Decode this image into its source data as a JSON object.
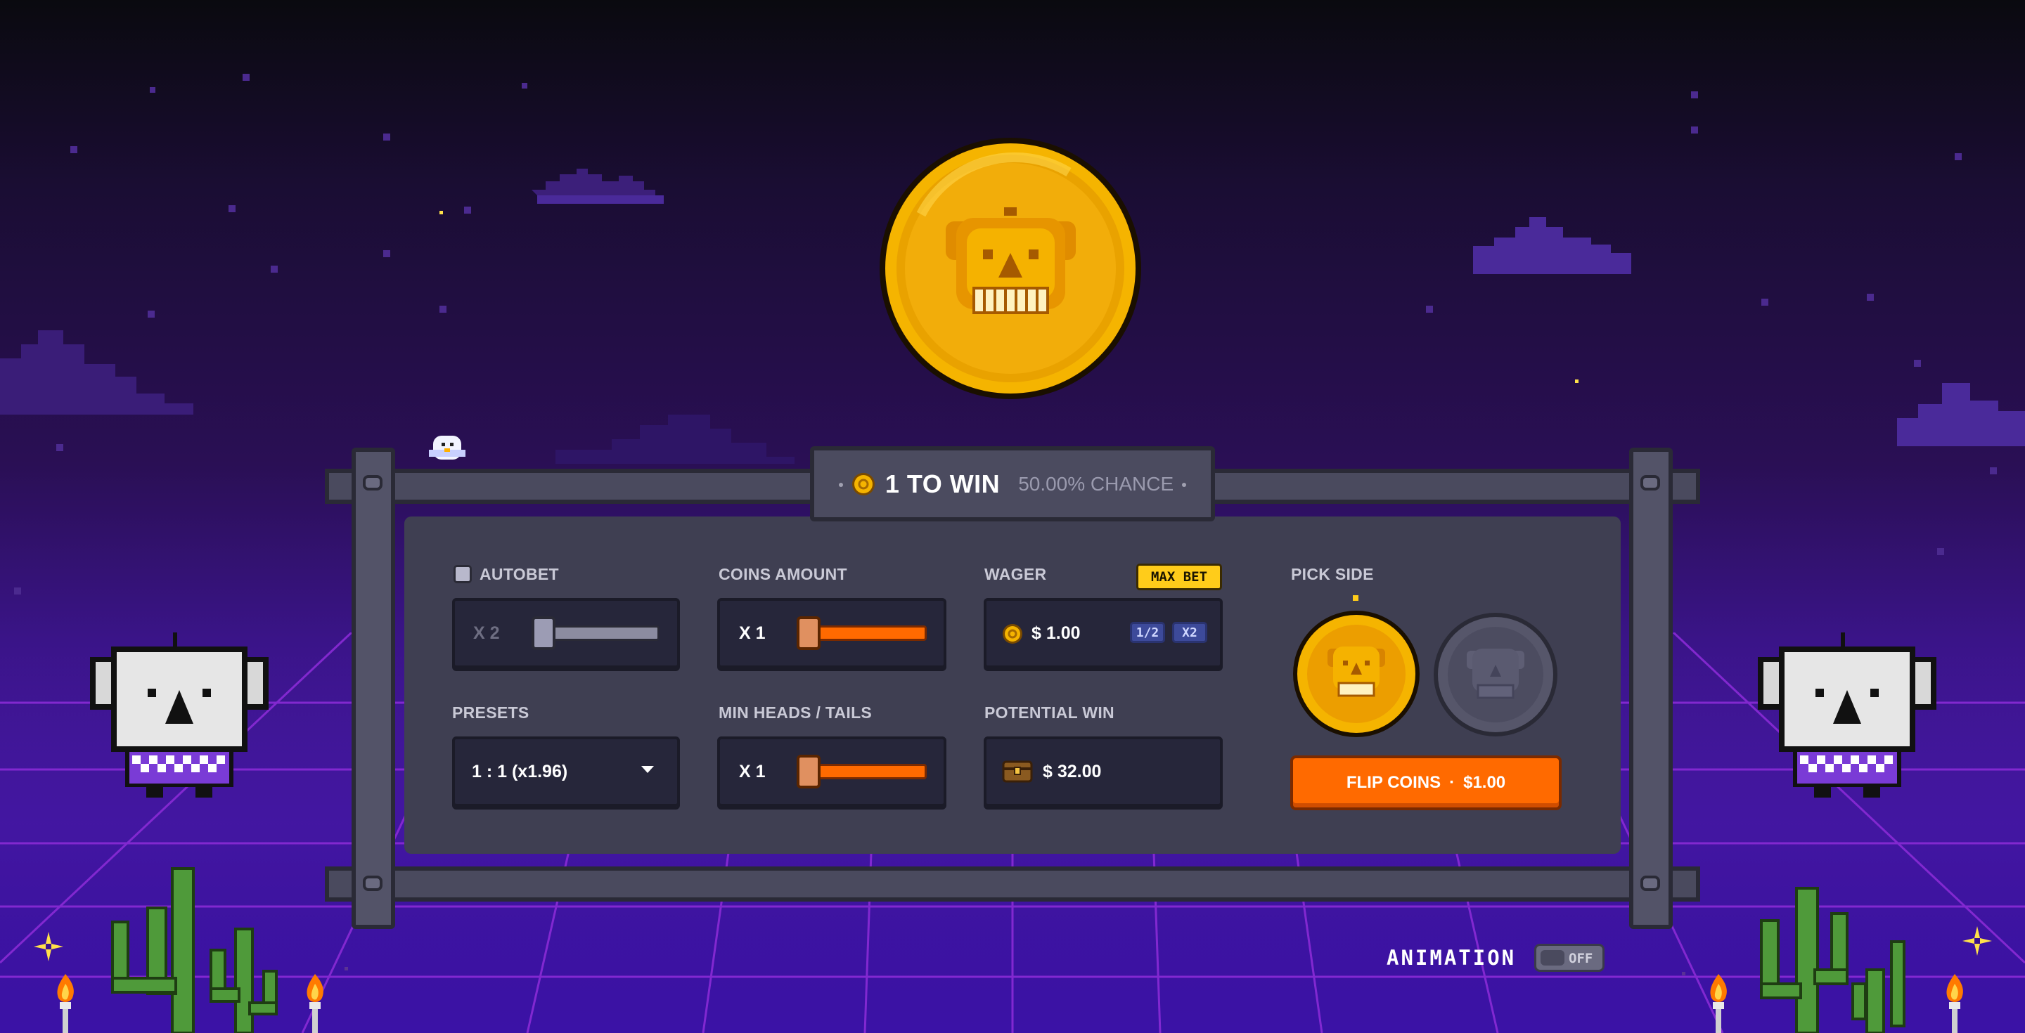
{
  "header": {
    "win_count": "1 TO WIN",
    "chance": "50.00% CHANCE"
  },
  "autobet": {
    "label": "AUTOBET",
    "checked": false,
    "multiplier": "X 2",
    "slider_level": 0
  },
  "coins_amount": {
    "label": "COINS AMOUNT",
    "value": "X 1",
    "slider_level": 1
  },
  "wager": {
    "label": "WAGER",
    "max_bet_label": "MAX BET",
    "amount": "$ 1.00",
    "half_label": "1/2",
    "double_label": "X2"
  },
  "presets": {
    "label": "PRESETS",
    "selected": "1 : 1 (x1.96)"
  },
  "min_heads_tails": {
    "label": "MIN HEADS / TAILS",
    "value": "X 1",
    "slider_level": 1
  },
  "potential_win": {
    "label": "POTENTIAL WIN",
    "amount": "$ 32.00",
    "icon": "treasure-chest-icon"
  },
  "pick_side": {
    "label": "PICK SIDE",
    "selected": "heads",
    "options": [
      "heads",
      "tails"
    ]
  },
  "flip": {
    "label": "FLIP COINS",
    "separator": "·",
    "amount": "$1.00"
  },
  "animation": {
    "label": "ANIMATION",
    "state": "OFF"
  },
  "colors": {
    "accent_orange": "#ff6a00",
    "gold": "#f5b400",
    "panel": "#3f3f52"
  }
}
